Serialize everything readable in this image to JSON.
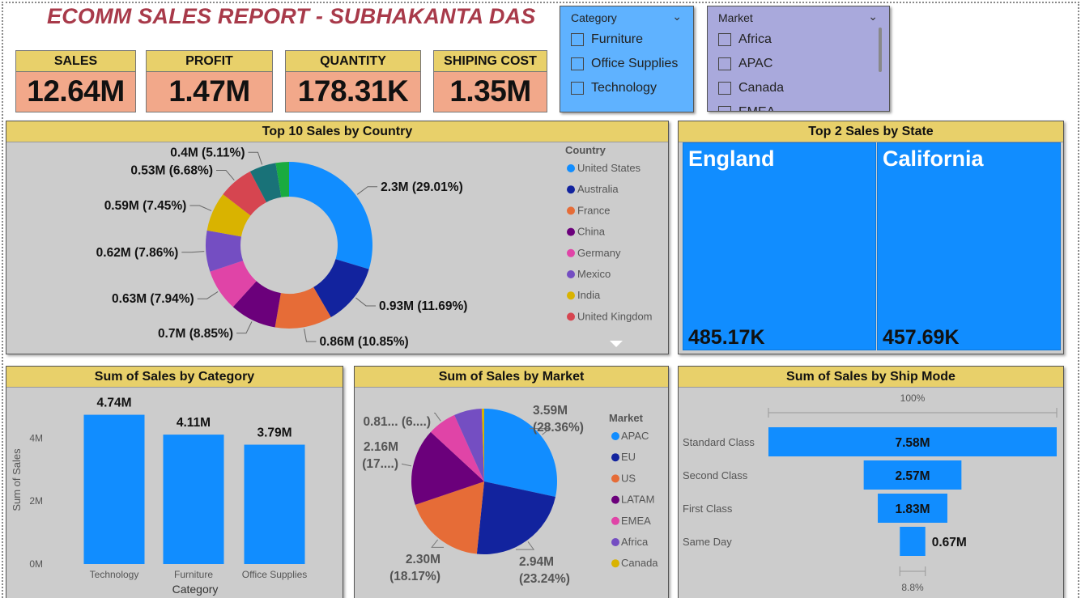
{
  "title": "ECOMM SALES REPORT - SUBHAKANTA DAS",
  "kpis": {
    "sales": {
      "label": "SALES",
      "value": "12.64M"
    },
    "profit": {
      "label": "PROFIT",
      "value": "1.47M"
    },
    "quantity": {
      "label": "QUANTITY",
      "value": "178.31K"
    },
    "shipping": {
      "label": "SHIPING COST",
      "value": "1.35M"
    }
  },
  "slicers": {
    "category": {
      "title": "Category",
      "items": [
        "Furniture",
        "Office Supplies",
        "Technology"
      ]
    },
    "market": {
      "title": "Market",
      "items": [
        "Africa",
        "APAC",
        "Canada",
        "EMEA"
      ]
    }
  },
  "colors": {
    "accent_yellow": "#e8d06a",
    "kpi_fill": "#f2a88a",
    "panel_bg": "#cccccc",
    "primary_blue": "#118dff",
    "title_red": "#a83a4a"
  },
  "chart_data": [
    {
      "type": "donut",
      "title": "Top 10 Sales by Country",
      "legend_title": "Country",
      "legend_placement": "right",
      "series": [
        {
          "name": "United States",
          "value": 2.3,
          "label": "2.3M (29.01%)",
          "color": "#118dff"
        },
        {
          "name": "Australia",
          "value": 0.93,
          "label": "0.93M (11.69%)",
          "color": "#12239e"
        },
        {
          "name": "France",
          "value": 0.86,
          "label": "0.86M (10.85%)",
          "color": "#e66c37"
        },
        {
          "name": "China",
          "value": 0.7,
          "label": "0.7M (8.85%)",
          "color": "#6b007b"
        },
        {
          "name": "Germany",
          "value": 0.63,
          "label": "0.63M (7.94%)",
          "color": "#e044a7"
        },
        {
          "name": "Mexico",
          "value": 0.62,
          "label": "0.62M (7.86%)",
          "color": "#744ec2"
        },
        {
          "name": "India",
          "value": 0.59,
          "label": "0.59M (7.45%)",
          "color": "#d9b300"
        },
        {
          "name": "United Kingdom",
          "value": 0.53,
          "label": "0.53M (6.68%)",
          "color": "#d64550"
        },
        {
          "value": 0.4,
          "label": "0.4M (5.11%)",
          "color": "#197278"
        },
        {
          "value": 0.2,
          "label": "",
          "color": "#1aab40"
        }
      ]
    },
    {
      "type": "treemap",
      "title": "Top 2 Sales by State",
      "series": [
        {
          "name": "England",
          "value": 485.17,
          "label": "485.17K"
        },
        {
          "name": "California",
          "value": 457.69,
          "label": "457.69K"
        }
      ]
    },
    {
      "type": "bar",
      "title": "Sum of Sales by Category",
      "xlabel": "Category",
      "ylabel": "Sum of Sales",
      "categories": [
        "Technology",
        "Furniture",
        "Office Supplies"
      ],
      "values": [
        4.74,
        4.11,
        3.79
      ],
      "value_labels": [
        "4.74M",
        "4.11M",
        "3.79M"
      ],
      "yticks": [
        "0M",
        "2M",
        "4M"
      ],
      "ylim": [
        0,
        5.5
      ]
    },
    {
      "type": "pie",
      "title": "Sum of Sales by Market",
      "legend_title": "Market",
      "legend_placement": "right",
      "series": [
        {
          "name": "APAC",
          "value": 3.59,
          "label": [
            "3.59M",
            "(28.36%)"
          ],
          "color": "#118dff"
        },
        {
          "name": "EU",
          "value": 2.94,
          "label": [
            "2.94M",
            "(23.24%)"
          ],
          "color": "#12239e"
        },
        {
          "name": "US",
          "value": 2.3,
          "label": [
            "2.30M",
            "(18.17%)"
          ],
          "color": "#e66c37"
        },
        {
          "name": "LATAM",
          "value": 2.16,
          "label": [
            "2.16M",
            "(17....)"
          ],
          "color": "#6b007b"
        },
        {
          "name": "EMEA",
          "value": 0.81,
          "label": [
            "0.81... (6....)"
          ],
          "color": "#e044a7"
        },
        {
          "name": "Africa",
          "value": 0.78,
          "label": [],
          "color": "#744ec2"
        },
        {
          "name": "Canada",
          "value": 0.07,
          "label": [],
          "color": "#d9b300"
        }
      ]
    },
    {
      "type": "funnel",
      "title": "Sum of Sales by Ship Mode",
      "top_label": "100%",
      "bottom_label": "8.8%",
      "categories": [
        "Standard Class",
        "Second Class",
        "First Class",
        "Same Day"
      ],
      "values": [
        7.58,
        2.57,
        1.83,
        0.67
      ],
      "value_labels": [
        "7.58M",
        "2.57M",
        "1.83M",
        "0.67M"
      ]
    }
  ]
}
